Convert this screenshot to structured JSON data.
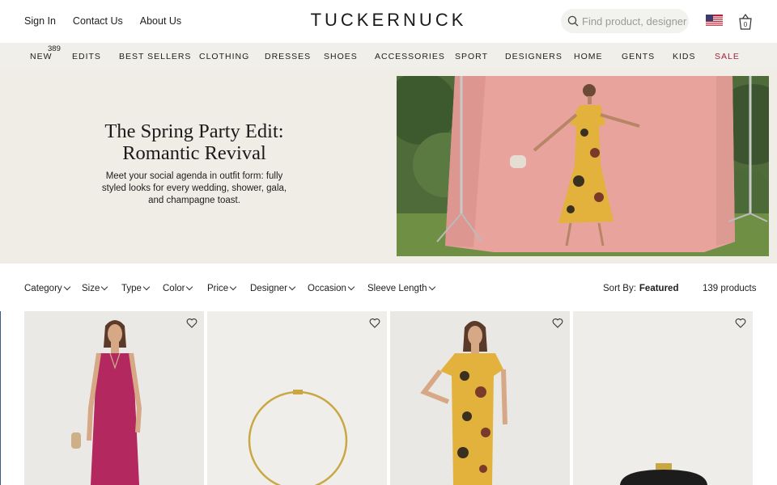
{
  "header": {
    "util_links": [
      "Sign In",
      "Contact Us",
      "About Us"
    ],
    "logo": "TUCKERNUCK",
    "search_placeholder": "Find product, designer,",
    "cart_count": "0"
  },
  "nav": {
    "new_badge": "389",
    "items": [
      "NEW",
      "EDITS",
      "BEST SELLERS",
      "CLOTHING",
      "DRESSES",
      "SHOES",
      "ACCESSORIES",
      "SPORT",
      "DESIGNERS",
      "HOME",
      "GENTS",
      "KIDS",
      "SALE"
    ],
    "sale_color": "#a3243b"
  },
  "hero": {
    "title_line1": "The Spring Party Edit:",
    "title_line2": "Romantic Revival",
    "description": "Meet your social agenda in outfit form: fully styled looks for every wedding, shower, gala, and champagne toast."
  },
  "filters": {
    "items": [
      "Category",
      "Size",
      "Type",
      "Color",
      "Price",
      "Designer",
      "Occasion",
      "Sleeve Length"
    ],
    "sort_label": "Sort By:",
    "sort_value": "Featured",
    "product_count": "139 products"
  },
  "products": [
    {
      "image": "pink-knit-dress"
    },
    {
      "image": "gold-collar-necklace"
    },
    {
      "image": "yellow-floral-dress"
    },
    {
      "image": "black-raffia-clutch"
    }
  ],
  "icons": {
    "search": "search-icon",
    "flag": "us-flag-icon",
    "cart": "shopping-bag-icon",
    "wishlist": "heart-icon"
  }
}
